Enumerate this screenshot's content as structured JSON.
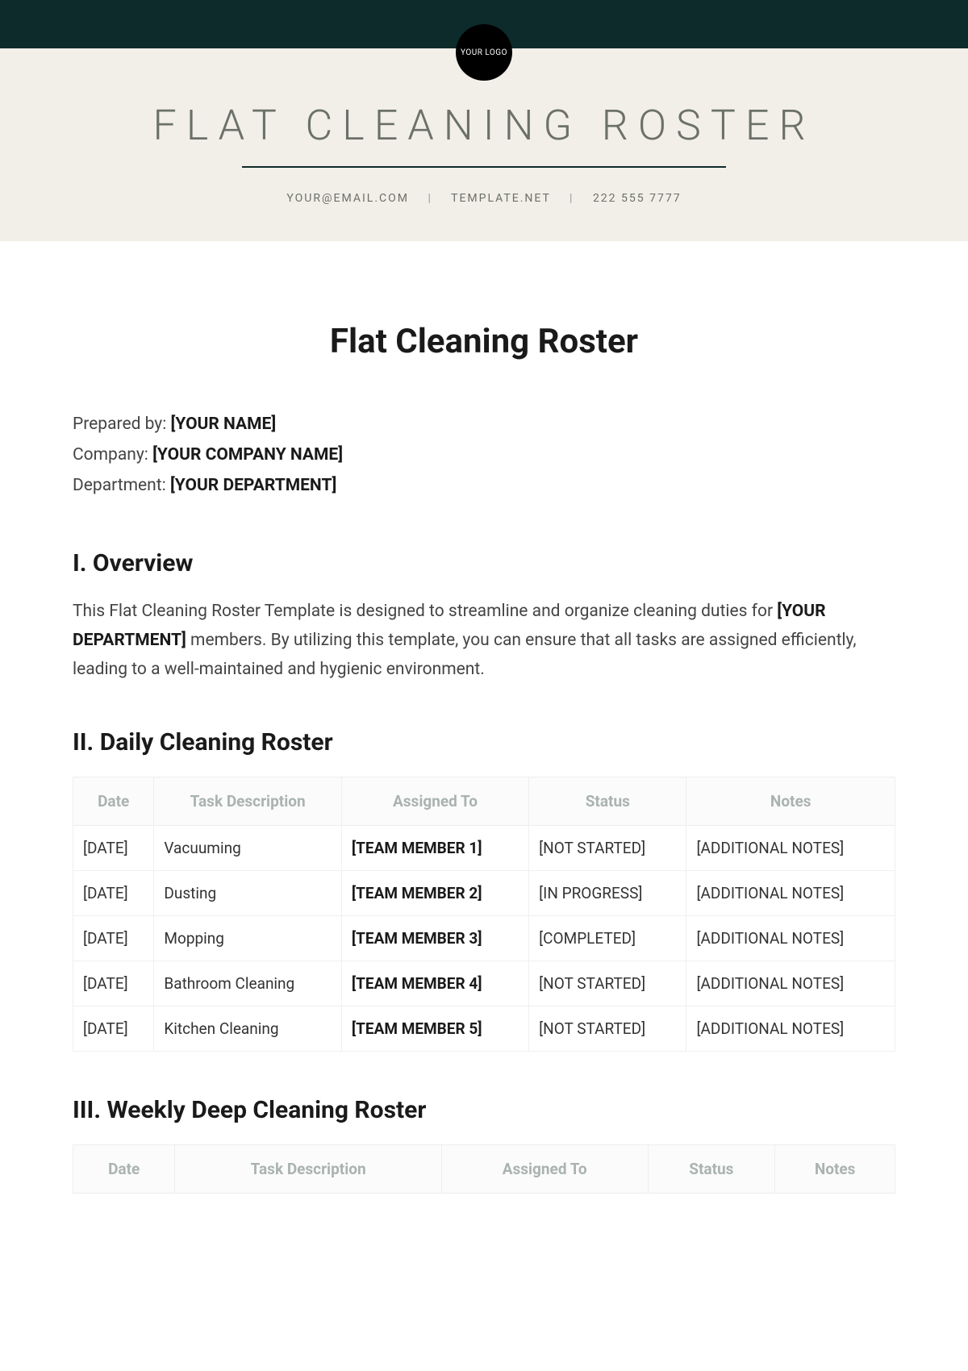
{
  "header": {
    "logo_text": "YOUR LOGO",
    "banner_title": "FLAT CLEANING ROSTER",
    "contact_email": "YOUR@EMAIL.COM",
    "contact_site": "TEMPLATE.NET",
    "contact_phone": "222 555 7777"
  },
  "document": {
    "title": "Flat Cleaning Roster",
    "meta": {
      "prepared_label": "Prepared by: ",
      "prepared_value": "[YOUR NAME]",
      "company_label": "Company: ",
      "company_value": "[YOUR COMPANY NAME]",
      "department_label": "Department: ",
      "department_value": "[YOUR DEPARTMENT]"
    },
    "sections": {
      "overview_heading": "I. Overview",
      "overview_p1": "This Flat Cleaning Roster Template is designed to streamline and organize cleaning duties for ",
      "overview_bold": "[YOUR DEPARTMENT]",
      "overview_p2": " members. By utilizing this template, you can ensure that all tasks are assigned efficiently, leading to a well-maintained and hygienic environment.",
      "daily_heading": "II. Daily Cleaning Roster",
      "weekly_heading": "III. Weekly Deep Cleaning Roster"
    },
    "columns": {
      "date": "Date",
      "task": "Task Description",
      "assigned": "Assigned To",
      "status": "Status",
      "notes": "Notes"
    },
    "daily_rows": [
      {
        "date": "[DATE]",
        "task": "Vacuuming",
        "assigned": "[TEAM MEMBER 1]",
        "status": "[NOT STARTED]",
        "notes": "[ADDITIONAL NOTES]"
      },
      {
        "date": "[DATE]",
        "task": "Dusting",
        "assigned": "[TEAM MEMBER 2]",
        "status": "[IN PROGRESS]",
        "notes": "[ADDITIONAL NOTES]"
      },
      {
        "date": "[DATE]",
        "task": "Mopping",
        "assigned": "[TEAM MEMBER 3]",
        "status": "[COMPLETED]",
        "notes": "[ADDITIONAL NOTES]"
      },
      {
        "date": "[DATE]",
        "task": "Bathroom Cleaning",
        "assigned": "[TEAM MEMBER 4]",
        "status": "[NOT STARTED]",
        "notes": "[ADDITIONAL NOTES]"
      },
      {
        "date": "[DATE]",
        "task": "Kitchen Cleaning",
        "assigned": "[TEAM MEMBER 5]",
        "status": "[NOT STARTED]",
        "notes": "[ADDITIONAL NOTES]"
      }
    ]
  }
}
